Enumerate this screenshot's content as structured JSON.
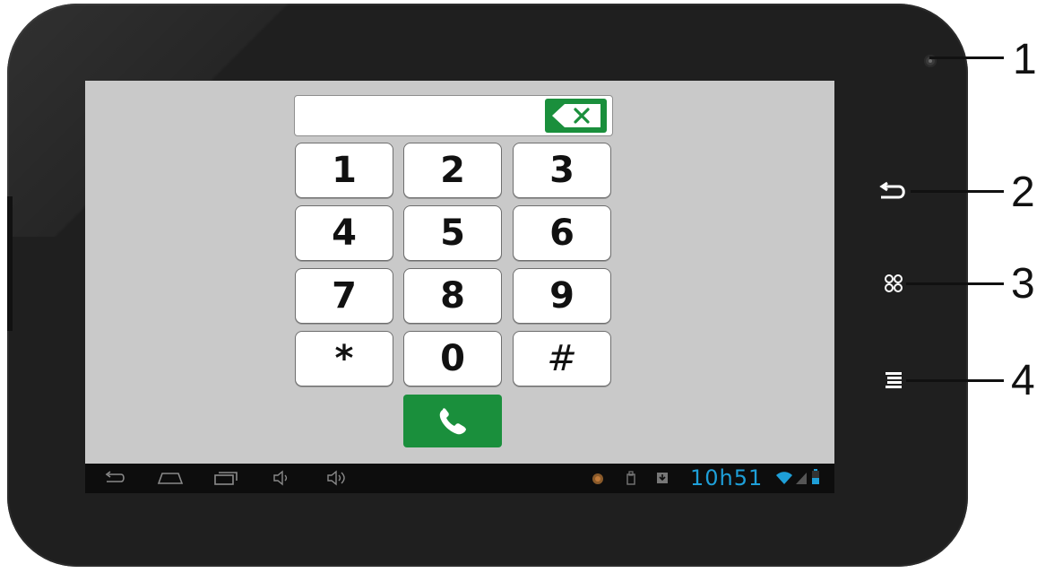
{
  "device": {
    "callouts": [
      "1",
      "2",
      "3",
      "4"
    ],
    "hardware_buttons": [
      "back-icon",
      "home-icon",
      "menu-icon"
    ]
  },
  "dialer": {
    "number_value": "",
    "backspace_icon": "backspace-icon",
    "keys": [
      "1",
      "2",
      "3",
      "4",
      "5",
      "6",
      "7",
      "8",
      "9",
      "*",
      "0",
      "#"
    ],
    "call_icon": "phone-icon",
    "accent": "#1a8f3c"
  },
  "navbar": {
    "icons": [
      "back-icon",
      "home-icon",
      "recent-apps-icon",
      "volume-down-icon",
      "volume-up-icon"
    ],
    "status_icons": [
      "notification-icon",
      "usb-icon",
      "download-icon",
      "wifi-icon",
      "signal-icon",
      "battery-icon"
    ],
    "clock": "10h51",
    "clock_color": "#1e9fd8"
  }
}
